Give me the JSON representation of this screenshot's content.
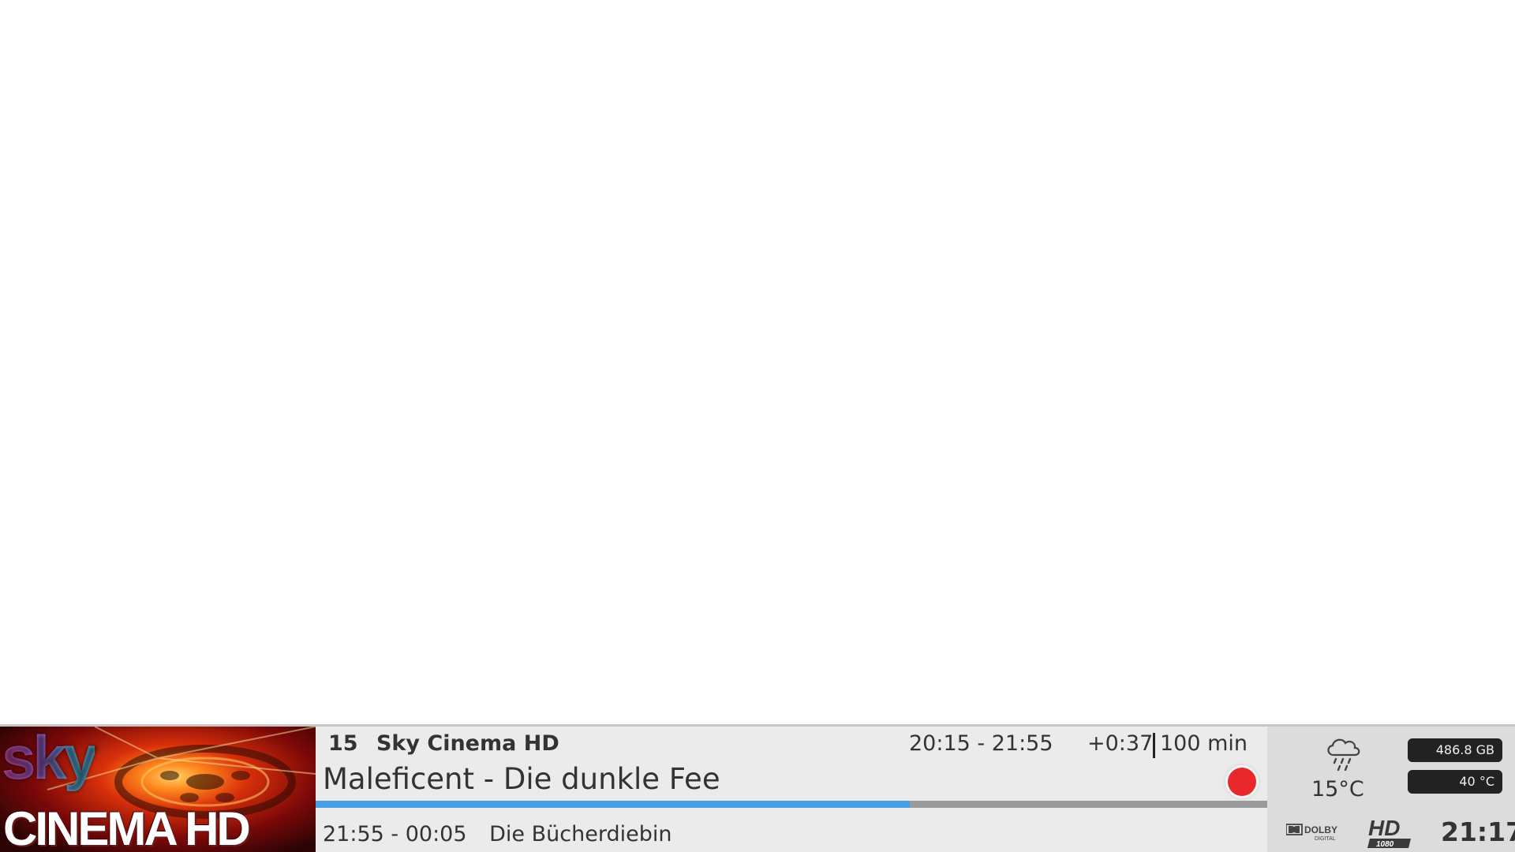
{
  "channel": {
    "number": "15",
    "name": "Sky Cinema HD",
    "logo_top_text": "sky",
    "logo_bottom_text": "CINEMA HD"
  },
  "current_event": {
    "time_range": "20:15 - 21:55",
    "elapsed": "+0:37",
    "duration": "100 min",
    "title": "Maleficent - Die dunkle Fee",
    "progress_percent": 62.4,
    "recording": true
  },
  "next_event": {
    "time_range": "21:55 - 00:05",
    "title": "Die Bücherdiebin"
  },
  "status": {
    "weather_icon": "rain-cloud-icon",
    "temperature": "15°C",
    "hdd_free": "486.8 GB",
    "cpu_temp": "40 °C",
    "audio_badge": "dolby-digital-icon",
    "video_badge": "hd-1080-icon",
    "clock": "21:17"
  },
  "colors": {
    "progress_fill": "#4a9ee6",
    "progress_track": "#9a9a9a",
    "record": "#e8282b",
    "bar_bg": "#ebebeb",
    "status_bg": "#dcdcdc"
  }
}
